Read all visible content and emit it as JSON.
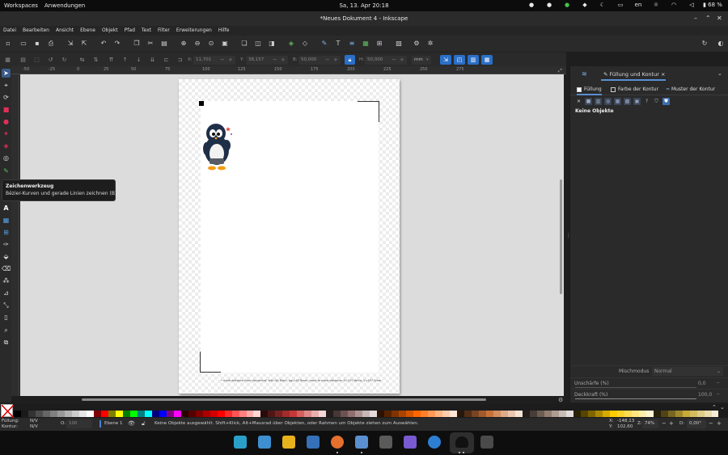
{
  "system_panel": {
    "workspaces": "Workspaces",
    "applications": "Anwendungen",
    "clock": "Sa, 13. Apr  20:18",
    "language": "en",
    "battery": "68 %"
  },
  "window": {
    "title": "*Neues Dokument 4 - Inkscape"
  },
  "menu": [
    "Datei",
    "Bearbeiten",
    "Ansicht",
    "Ebene",
    "Objekt",
    "Pfad",
    "Text",
    "Filter",
    "Erweiterungen",
    "Hilfe"
  ],
  "tool_controls": {
    "x_label": "X:",
    "x_value": "11,701",
    "y_label": "Y:",
    "y_value": "38,157",
    "w_label": "B:",
    "w_value": "50,000",
    "h_label": "H:",
    "h_value": "50,000",
    "unit": "mm"
  },
  "ruler_labels": [
    "-50",
    "-25",
    "0",
    "25",
    "50",
    "75",
    "100",
    "125",
    "150",
    "175",
    "200",
    "225",
    "250",
    "275"
  ],
  "tooltip": {
    "title": "Zeichenwerkzeug",
    "description": "Bézier-Kurven und gerade Linien zeichnen (B)"
  },
  "canvas": {
    "page_footnote": "• mark distance from document: left=40 8mm, top=03 8mm; mark to mark distance: H=170 6mm, V=257 0mm"
  },
  "dock": {
    "tab_title": "Füllung und Kontur",
    "subtabs": [
      "Füllung",
      "Farbe der Kontur",
      "Muster der Kontur"
    ],
    "no_objects": "Keine Objekte",
    "blend_label": "Mischmodus",
    "blend_value": "Normal",
    "blur_label": "Unschärfe (%)",
    "blur_value": "0,0",
    "opacity_label": "Deckkraft (%)",
    "opacity_value": "100,0"
  },
  "status": {
    "fill_label": "Füllung:",
    "fill_value": "N/V",
    "stroke_label": "Kontur:",
    "stroke_value": "N/V",
    "o_label": "O:",
    "o_value": "100",
    "layer": "Ebene 1",
    "message": "Keine Objekte ausgewählt. Shift+Klick, Alt+Mausrad über Objekten, oder Rahmen um Objekte ziehen zum Auswählen.",
    "x_label": "X:",
    "x_value": "-148,13",
    "y_label": "Y:",
    "y_value": "102,60",
    "zoom_label": "Z:",
    "zoom_value": "74%",
    "rot_label": "D:",
    "rot_value": "0,00°"
  },
  "palette_colors": [
    "#000000",
    "#1a1a1a",
    "#333333",
    "#4d4d4d",
    "#666666",
    "#808080",
    "#999999",
    "#b3b3b3",
    "#cccccc",
    "#e6e6e6",
    "#ffffff",
    "#800000",
    "#ff0000",
    "#808000",
    "#ffff00",
    "#008000",
    "#00ff00",
    "#008080",
    "#00ffff",
    "#000080",
    "#0000ff",
    "#800080",
    "#ff00ff",
    "#2b0000",
    "#550000",
    "#800000",
    "#aa0000",
    "#d40000",
    "#ff0000",
    "#ff2a2a",
    "#ff5555",
    "#ff8080",
    "#ffaaaa",
    "#ffd5d5",
    "#280b0b",
    "#501616",
    "#782121",
    "#a02c2c",
    "#c83737",
    "#d35f5f",
    "#de8787",
    "#e9afaf",
    "#f4d7d7",
    "#241c1c",
    "#483737",
    "#6c5353",
    "#916f6f",
    "#ac9393",
    "#c8b7b7",
    "#e3dbdb",
    "#2b1100",
    "#552200",
    "#803300",
    "#aa4400",
    "#d45500",
    "#ff6600",
    "#ff7f2a",
    "#ff9955",
    "#ffb380",
    "#ffccaa",
    "#ffe6d5",
    "#28170b",
    "#502d16",
    "#784421",
    "#a05a2c",
    "#c87137",
    "#d38d5f",
    "#deaa87",
    "#e9c6af",
    "#f4e3d7",
    "#241f1c",
    "#483e37",
    "#6c5d53",
    "#917c6f",
    "#ac9d93",
    "#c8beb7",
    "#e3dedb",
    "#2b2200",
    "#554400",
    "#806600",
    "#aa8800",
    "#d4aa00",
    "#ffcc00",
    "#ffd42a",
    "#ffdd55",
    "#ffe680",
    "#ffeeaa",
    "#fff6d5",
    "#28220b",
    "#504416",
    "#786721",
    "#a0892c",
    "#c8ab37",
    "#d3bc5f",
    "#decd87",
    "#e9ddaf",
    "#f4eed7"
  ]
}
